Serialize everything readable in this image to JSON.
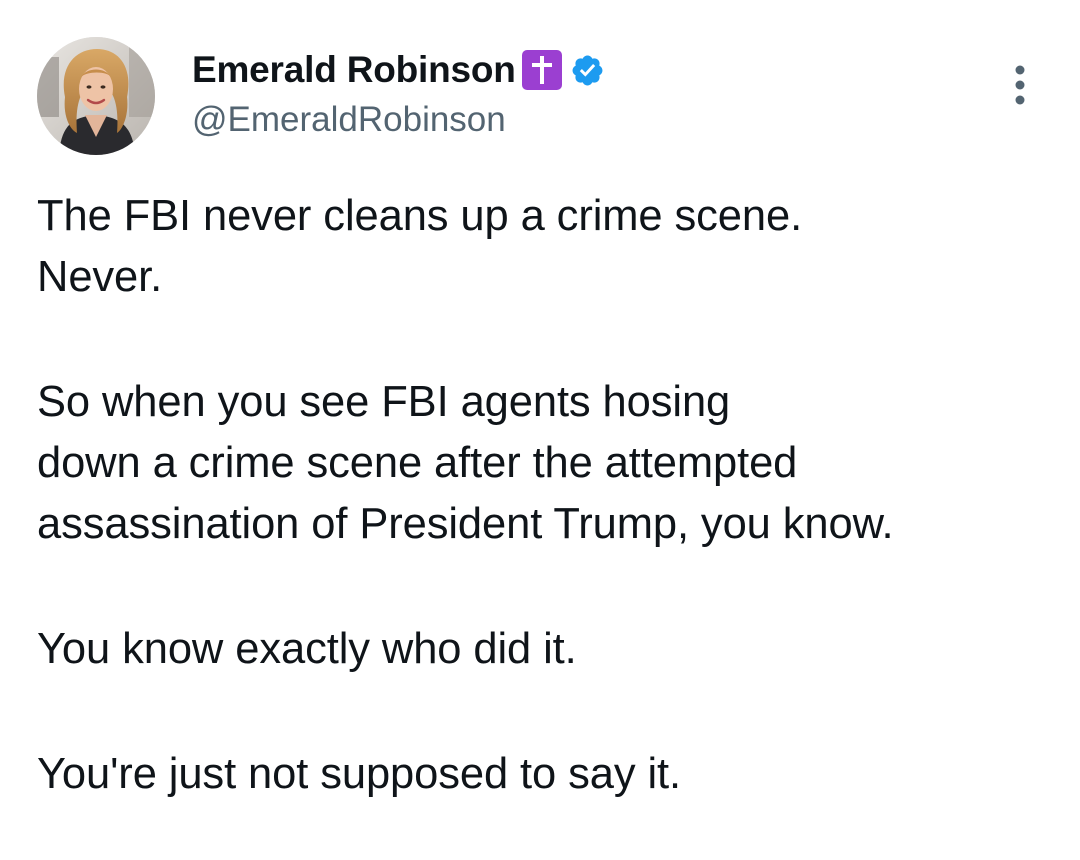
{
  "author": {
    "display_name": "Emerald Robinson",
    "handle": "@EmeraldRobinson",
    "name_emoji": "latin-cross-emoji",
    "verified": true,
    "verified_color": "#1d9bf0",
    "emoji_color": "#9b3fd1"
  },
  "icons": {
    "avatar": "profile-photo",
    "more": "more-vertical-icon",
    "verified": "verified-badge-icon"
  },
  "tweet": {
    "paragraphs": [
      "The FBI never cleans up a crime scene.\nNever.",
      "So when you see FBI agents hosing\ndown a crime scene after the attempted\nassassination of President Trump, you know.",
      "You know exactly who did it.",
      "You're just not supposed to say it."
    ]
  },
  "colors": {
    "text": "#0f1419",
    "secondary_text": "#536471",
    "background": "#ffffff"
  }
}
